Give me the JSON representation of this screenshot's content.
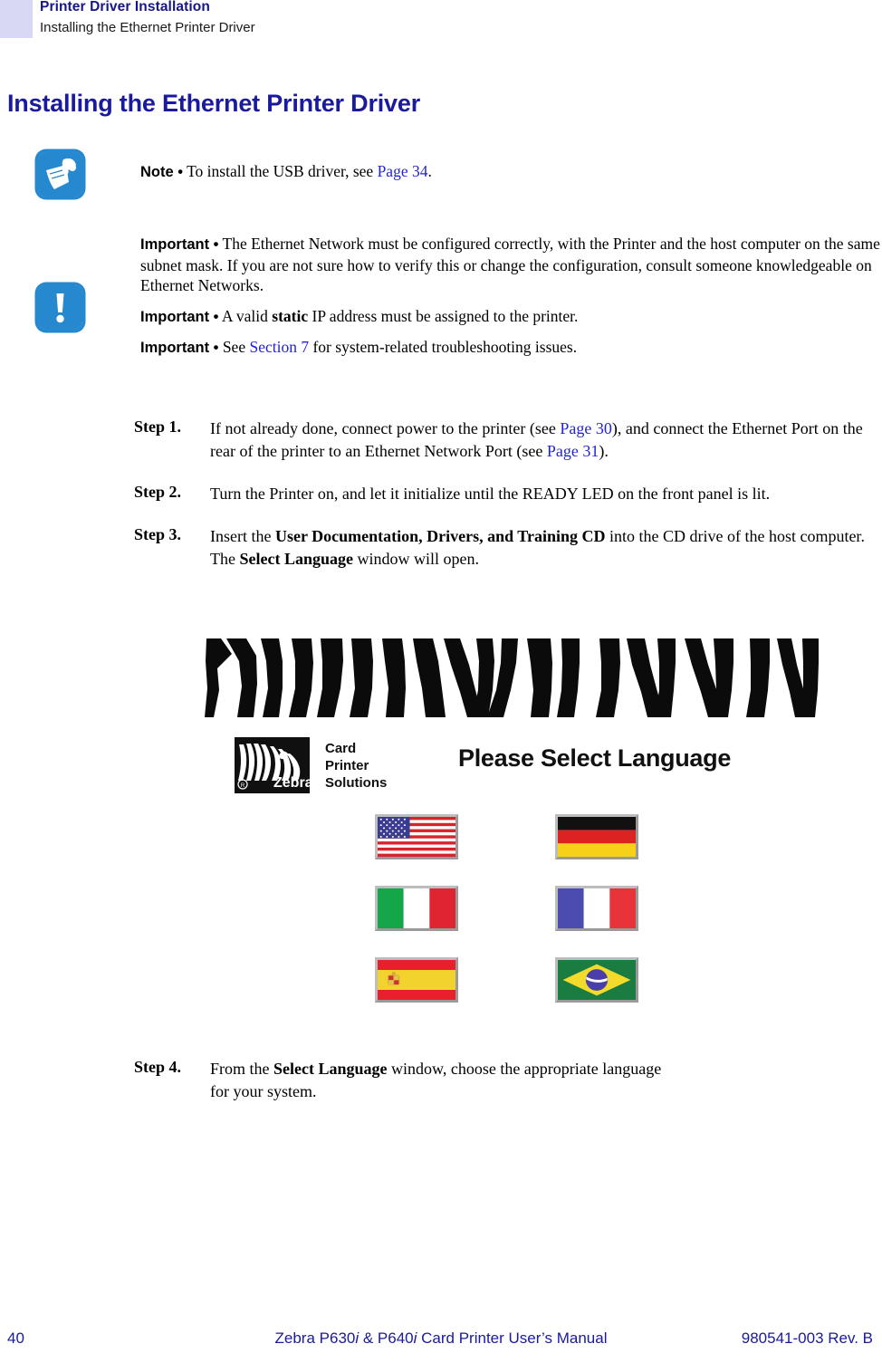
{
  "header": {
    "chapter": "Printer Driver Installation",
    "section": "Installing the Ethernet Printer Driver"
  },
  "page_title": "Installing the Ethernet Printer Driver",
  "note": {
    "icon": "note-document-icon",
    "lead": "Note •",
    "text_before": " To install the USB driver, see ",
    "xref": "Page 34",
    "text_after": "."
  },
  "important": {
    "icon": "exclamation-mark-icon",
    "items": [
      {
        "lead": "Important •",
        "text": " The Ethernet Network must be configured correctly, with the Printer and the host computer on the same subnet mask. If you are not sure how to verify this or change the configuration, consult someone knowledgeable on Ethernet Networks."
      },
      {
        "lead": "Important •",
        "text_1": " A valid ",
        "bold": "static",
        "text_2": " IP address must be assigned to the printer."
      },
      {
        "lead": "Important •",
        "text_1": " See ",
        "xref": "Section 7",
        "text_2": " for system-related troubleshooting issues."
      }
    ]
  },
  "steps": [
    {
      "label": "Step 1.",
      "seg_1": "If not already done, connect power to the printer (see ",
      "xref_1": "Page 30",
      "seg_2": "), and connect the Ethernet Port on the rear of the printer to an Ethernet Network Port (see ",
      "xref_2": "Page 31",
      "seg_3": ")."
    },
    {
      "label": "Step 2.",
      "seg_1": "Turn the Printer on, and let it initialize until the READY LED on the front panel is lit."
    },
    {
      "label": "Step 3.",
      "seg_1": "Insert the ",
      "bold_1": "User Documentation, Drivers, and Training CD",
      "seg_2": " into the CD drive of the host computer. The ",
      "bold_2": "Select Language",
      "seg_3": " window will open."
    },
    {
      "label": "Step 4.",
      "seg_1": "From the ",
      "bold_1": "Select Language",
      "seg_2": " window, choose the appropriate language for your system."
    }
  ],
  "splash": {
    "brand_name": "Zebra",
    "brand_tagline_line1": "Card",
    "brand_tagline_line2": "Printer",
    "brand_tagline_line3": "Solutions",
    "heading": "Please Select Language",
    "flags": [
      {
        "name": "united-states",
        "row": 0,
        "col": 0
      },
      {
        "name": "germany",
        "row": 0,
        "col": 1
      },
      {
        "name": "italy",
        "row": 1,
        "col": 0
      },
      {
        "name": "france",
        "row": 1,
        "col": 1
      },
      {
        "name": "spain",
        "row": 2,
        "col": 0
      },
      {
        "name": "brazil",
        "row": 2,
        "col": 1
      }
    ]
  },
  "footer": {
    "page_number": "40",
    "manual_title_1": "Zebra P630",
    "manual_title_i1": "i",
    "manual_title_2": " & P640",
    "manual_title_i2": "i",
    "manual_title_3": " Card Printer User’s Manual",
    "doc_number": "980541-003 Rev. B"
  },
  "colors": {
    "heading_blue": "#1a1a9c",
    "xref_blue": "#2222d8",
    "icon_blue": "#2688cf",
    "header_swatch": "#d8d8f5"
  }
}
